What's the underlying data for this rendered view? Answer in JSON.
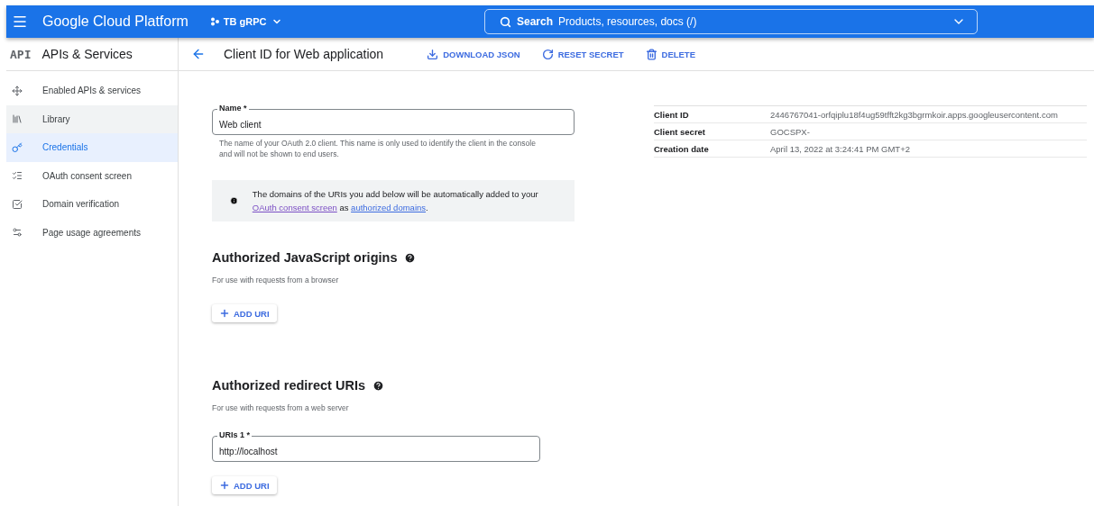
{
  "header": {
    "product": "Google Cloud Platform",
    "project": "TB gRPC",
    "search_label": "Search",
    "search_placeholder": "Products, resources, docs (/)"
  },
  "sidebar": {
    "badge": "API",
    "title": "APIs & Services",
    "items": [
      {
        "label": "Enabled APIs & services",
        "selected": false,
        "hovered": false
      },
      {
        "label": "Library",
        "selected": false,
        "hovered": true
      },
      {
        "label": "Credentials",
        "selected": true,
        "hovered": false
      },
      {
        "label": "OAuth consent screen",
        "selected": false,
        "hovered": false
      },
      {
        "label": "Domain verification",
        "selected": false,
        "hovered": false
      },
      {
        "label": "Page usage agreements",
        "selected": false,
        "hovered": false
      }
    ]
  },
  "toolbar": {
    "title": "Client ID for Web application",
    "actions": [
      {
        "label": "DOWNLOAD JSON"
      },
      {
        "label": "RESET SECRET"
      },
      {
        "label": "DELETE"
      }
    ]
  },
  "name_field": {
    "label": "Name *",
    "value": "Web client",
    "help": "The name of your OAuth 2.0 client. This name is only used to identify the client in the console and will not be shown to end users."
  },
  "info": {
    "before": "The domains of the URIs you add below will be automatically added to your ",
    "link1": "OAuth consent screen",
    "middle": " as ",
    "link2": "authorized domains",
    "after": "."
  },
  "sections": [
    {
      "title": "Authorized JavaScript origins",
      "subtitle": "For use with requests from a browser",
      "button": "ADD URI"
    },
    {
      "title": "Authorized redirect URIs",
      "subtitle": "For use with requests from a web server",
      "uris": [
        {
          "label": "URIs 1 *",
          "value": "http://localhost"
        }
      ],
      "button": "ADD URI"
    }
  ],
  "details": [
    {
      "label": "Client ID",
      "value": "2446767041-orfqiplu18f4ug59tfft2kg3bgrmkoir.apps.googleusercontent.com"
    },
    {
      "label": "Client secret",
      "value": "GOCSPX-"
    },
    {
      "label": "Creation date",
      "value": "April 13, 2022 at 3:24:41 PM GMT+2"
    }
  ]
}
